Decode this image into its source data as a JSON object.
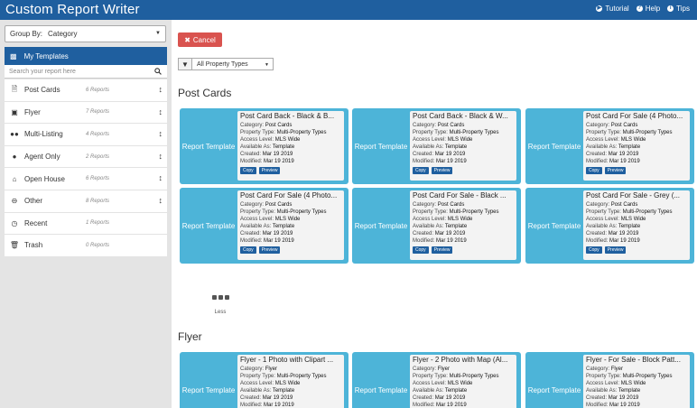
{
  "app": {
    "title": "Custom Report Writer",
    "links": [
      {
        "label": "Tutorial",
        "icon": "play-circle-icon"
      },
      {
        "label": "Help",
        "icon": "question-circle-icon"
      },
      {
        "label": "Tips",
        "icon": "info-circle-icon"
      }
    ]
  },
  "sidebar": {
    "group_by_label": "Group By:",
    "group_by_value": "Category",
    "my_templates": "My Templates",
    "search_placeholder": "Search your report here",
    "categories": [
      {
        "name": "Post Cards",
        "count": "6 Reports",
        "icon": "document-icon"
      },
      {
        "name": "Flyer",
        "count": "7 Reports",
        "icon": "image-icon"
      },
      {
        "name": "Multi-Listing",
        "count": "4 Reports",
        "icon": "users-icon"
      },
      {
        "name": "Agent Only",
        "count": "2 Reports",
        "icon": "user-icon"
      },
      {
        "name": "Open House",
        "count": "6 Reports",
        "icon": "home-icon"
      },
      {
        "name": "Other",
        "count": "8 Reports",
        "icon": "minus-circle-icon"
      },
      {
        "name": "Recent",
        "count": "1 Reports",
        "icon": "clock-icon"
      },
      {
        "name": "Trash",
        "count": "0 Reports",
        "icon": "trash-icon"
      }
    ]
  },
  "main": {
    "cancel_label": "Cancel",
    "filter_value": "All Property Types",
    "less_label": "Less",
    "thumb_text": "Report Template",
    "labels": {
      "category": "Category:",
      "property_type": "Property Type:",
      "access_level": "Access Level:",
      "available_as": "Available As:",
      "created": "Created:",
      "modified": "Modified:",
      "copy": "Copy",
      "preview": "Preview"
    },
    "sections": [
      {
        "title": "Post Cards",
        "cards": [
          {
            "title": "Post Card Back - Black & B...",
            "category": "Post Cards",
            "property_type": "Multi-Property Types",
            "access_level": "MLS Wide",
            "available_as": "Template",
            "created": "Mar 19 2019",
            "modified": "Mar 19 2019"
          },
          {
            "title": "Post Card Back - Black & W...",
            "category": "Post Cards",
            "property_type": "Multi-Property Types",
            "access_level": "MLS Wide",
            "available_as": "Template",
            "created": "Mar 19 2019",
            "modified": "Mar 19 2019"
          },
          {
            "title": "Post Card For Sale (4 Photo...",
            "category": "Post Cards",
            "property_type": "Multi-Property Types",
            "access_level": "MLS Wide",
            "available_as": "Template",
            "created": "Mar 19 2019",
            "modified": "Mar 19 2019"
          },
          {
            "title": "Post Card For Sale (4 Photo...",
            "category": "Post Cards",
            "property_type": "Multi-Property Types",
            "access_level": "MLS Wide",
            "available_as": "Template",
            "created": "Mar 19 2019",
            "modified": "Mar 19 2019"
          },
          {
            "title": "Post Card For Sale - Black ...",
            "category": "Post Cards",
            "property_type": "Multi-Property Types",
            "access_level": "MLS Wide",
            "available_as": "Template",
            "created": "Mar 19 2019",
            "modified": "Mar 19 2019"
          },
          {
            "title": "Post Card For Sale - Grey (...",
            "category": "Post Cards",
            "property_type": "Multi-Property Types",
            "access_level": "MLS Wide",
            "available_as": "Template",
            "created": "Mar 19 2019",
            "modified": "Mar 19 2019"
          }
        ]
      },
      {
        "title": "Flyer",
        "cards": [
          {
            "title": "Flyer - 1 Photo with Clipart ...",
            "category": "Flyer",
            "property_type": "Multi-Property Types",
            "access_level": "MLS Wide",
            "available_as": "Template",
            "created": "Mar 19 2019",
            "modified": "Mar 19 2019"
          },
          {
            "title": "Flyer - 2 Photo with Map (Al...",
            "category": "Flyer",
            "property_type": "Multi-Property Types",
            "access_level": "MLS Wide",
            "available_as": "Template",
            "created": "Mar 19 2019",
            "modified": "Mar 19 2019"
          },
          {
            "title": "Flyer - For Sale - Block Patt...",
            "category": "Flyer",
            "property_type": "Multi-Property Types",
            "access_level": "MLS Wide",
            "available_as": "Template",
            "created": "Mar 19 2019",
            "modified": "Mar 19 2019"
          }
        ]
      }
    ]
  }
}
